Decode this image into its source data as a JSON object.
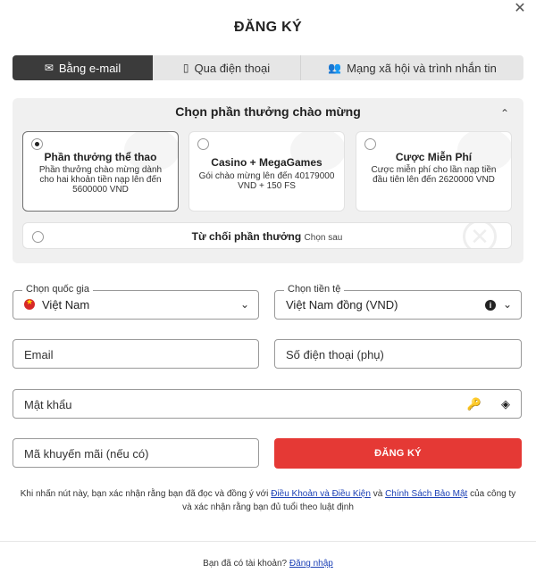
{
  "header": {
    "title": "ĐĂNG KÝ",
    "close_icon": "close-icon"
  },
  "tabs": [
    {
      "label": "Bằng e-mail",
      "icon": "envelope-icon",
      "active": true
    },
    {
      "label": "Qua điện thoại",
      "icon": "phone-icon",
      "active": false
    },
    {
      "label": "Mạng xã hội và trình nhắn tin",
      "icon": "users-icon",
      "active": false
    }
  ],
  "bonus": {
    "title": "Chọn phần thưởng chào mừng",
    "cards": [
      {
        "title": "Phần thưởng thể thao",
        "desc": "Phần thưởng chào mừng dành cho hai khoản tiền nạp lên đến 5600000 VND",
        "selected": true
      },
      {
        "title": "Casino + MegaGames",
        "desc": "Gói chào mừng lên đến 40179000 VND + 150 FS",
        "selected": false
      },
      {
        "title": "Cược Miễn Phí",
        "desc": "Cược miễn phí cho lần nạp tiền đầu tiên lên đến 2620000 VND",
        "selected": false
      }
    ],
    "decline_label": "Từ chối phần thưởng",
    "decline_later": "Chọn sau"
  },
  "form": {
    "country_label": "Chọn quốc gia",
    "country_value": "Việt Nam",
    "currency_label": "Chọn tiền tệ",
    "currency_value": "Việt Nam đồng (VND)",
    "email_placeholder": "Email",
    "phone_placeholder": "Số điện thoại (phụ)",
    "password_placeholder": "Mật khẩu",
    "promo_placeholder": "Mã khuyến mãi (nếu có)",
    "submit_label": "ĐĂNG KÝ"
  },
  "terms": {
    "prefix": "Khi nhấn nút này, bạn xác nhận rằng bạn đã đọc và đồng ý với",
    "link1": "Điều Khoản và Điều Kiện",
    "mid": "và",
    "link2": "Chính Sách Bảo Mật",
    "suffix": "của công ty và xác nhận rằng bạn đủ tuổi theo luật định"
  },
  "footer": {
    "question": "Bạn đã có tài khoản?",
    "login_link": "Đăng nhập"
  },
  "colors": {
    "accent": "#e53935",
    "active_tab": "#3b3b3b",
    "link": "#1a3fb5",
    "panel": "#f0f0f0"
  }
}
